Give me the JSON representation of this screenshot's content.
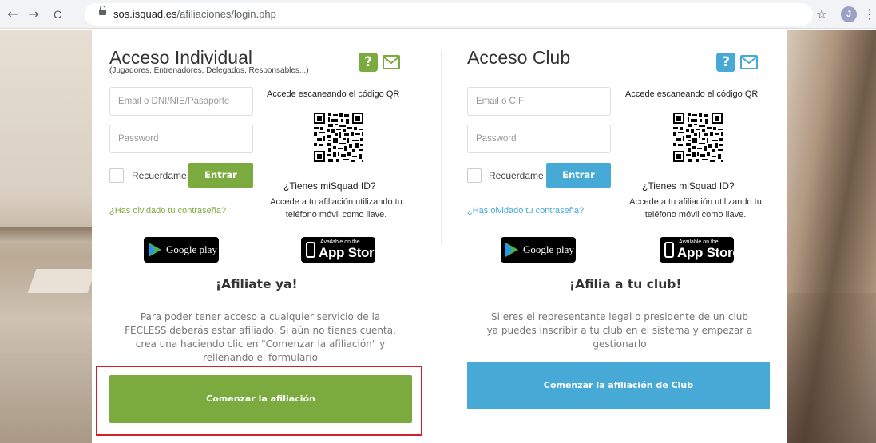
{
  "browser": {
    "url_host": "sos.isquad.es",
    "url_path": "/afiliaciones/login.php",
    "back_icon": "←",
    "forward_icon": "→",
    "reload_icon": "C",
    "star_icon": "☆",
    "profile_initial": "J",
    "menu_icon": "⋮"
  },
  "colors": {
    "green": "#7bab3f",
    "blue": "#47a9d6",
    "highlight_red": "#d0212a"
  },
  "individual": {
    "title": "Acceso Individual",
    "subtitle": "(Jugadores, Entrenadores, Delegados, Responsables...)",
    "help_label": "?",
    "email_placeholder": "Email o DNI/NIE/Pasaporte",
    "password_placeholder": "Password",
    "remember_label": "Recuerdame",
    "login_button": "Entrar",
    "forgot_link": "¿Has olvidado tu contraseña?",
    "qr_title": "Accede escaneando el código QR",
    "misquad_question": "¿Tienes miSquad ID?",
    "misquad_desc": "Accede a tu afiliación utilizando tu teléfono móvil como llave.",
    "google_play_label": "Google play",
    "app_store_small": "Available on the",
    "app_store_big": "App Store",
    "section_title": "¡Afiliate ya!",
    "paragraph": "Para poder tener acceso a cualquier servicio de la FECLESS deberás estar afiliado. Si aún no tienes cuenta, crea una haciendo clic en \"Comenzar la afiliación\" y rellenando el formulario",
    "cta_button": "Comenzar la afiliación"
  },
  "club": {
    "title": "Acceso Club",
    "help_label": "?",
    "email_placeholder": "Email o CIF",
    "password_placeholder": "Password",
    "remember_label": "Recuerdame",
    "login_button": "Entrar",
    "forgot_link": "¿Has olvidado tu contraseña?",
    "qr_title": "Accede escaneando el código QR",
    "misquad_question": "¿Tienes miSquad ID?",
    "misquad_desc": "Accede a tu afiliación utilizando tu teléfono móvil como llave.",
    "google_play_label": "Google play",
    "app_store_small": "Available on the",
    "app_store_big": "App Store",
    "section_title": "¡Afilia a tu club!",
    "paragraph": "Si eres el representante legal o presidente de un club ya puedes inscribir a tu club en el sistema y empezar a gestionarlo",
    "cta_button": "Comenzar la afiliación de Club"
  }
}
